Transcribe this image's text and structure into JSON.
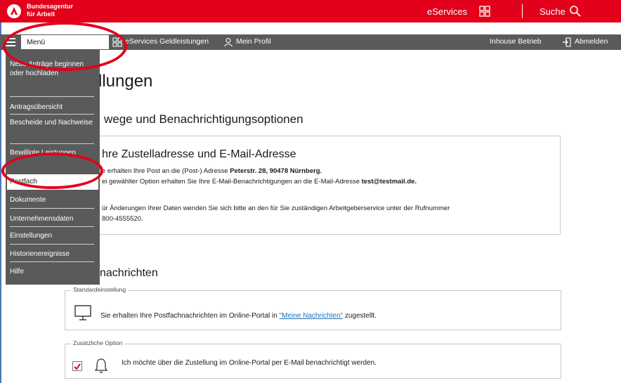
{
  "header": {
    "brand_line1": "Bundesagentur",
    "brand_line2": "für Arbeit",
    "eservices_label": "eServices",
    "search_label": "Suche",
    "brand_color": "#e2001a"
  },
  "navbar": {
    "menu_label": "Menü",
    "eservices_geld_label": "eServices Geldleistungen",
    "profile_label": "Mein Profil",
    "inhouse_label": "Inhouse Betrieb",
    "logout_label": "Abmelden"
  },
  "dropdown": {
    "items": [
      {
        "label": "Neue Anträge beginnen oder hochladen"
      },
      {
        "label": "Antragsübersicht"
      },
      {
        "label": "Bescheide und Nachweise"
      },
      {
        "label": "Bewilligte Leistungen"
      },
      {
        "label": "Postfach"
      },
      {
        "label": "Dokumente"
      },
      {
        "label": "Unternehmensdaten"
      },
      {
        "label": "Einstellungen"
      },
      {
        "label": "Historienereignisse"
      },
      {
        "label": "Hilfe"
      }
    ],
    "active_index": 4
  },
  "main": {
    "title": "llungen",
    "subtitle": "wege und Benachrichtigungsoptionen",
    "address_box": {
      "title": "hre Zustelladresse und E-Mail-Adresse",
      "line1_prefix": "e erhalten Ihre Post an die (Post-) Adresse ",
      "line1_bold": "Peterstr. 28, 90478 Nürnberg.",
      "line2_prefix": "ei gewählter Option erhalten Sie Ihre E-Mail-Benachrichtigungen an die E-Mail-Adresse ",
      "line2_bold": "test@testmail.de.",
      "line3": "ür Änderungen Ihrer Daten wenden Sie sich bitte an den für Sie zuständigen Arbeitgeberservice unter der Rufnummer",
      "line4": "800-4555520."
    },
    "messages_section": {
      "title": "nachrichten",
      "standard": {
        "legend": "Standardeinstellung",
        "text_prefix": "Sie erhalten Ihre Postfachnachrichten im Online-Portal in ",
        "link": "\"Meine Nachrichten\"",
        "text_suffix": " zugestellt."
      },
      "additional": {
        "legend": "Zusätzliche Option",
        "text": "Ich möchte über die Zustellung im Online-Portal per E-Mail benachrichtigt werden.",
        "checked": true
      }
    }
  }
}
